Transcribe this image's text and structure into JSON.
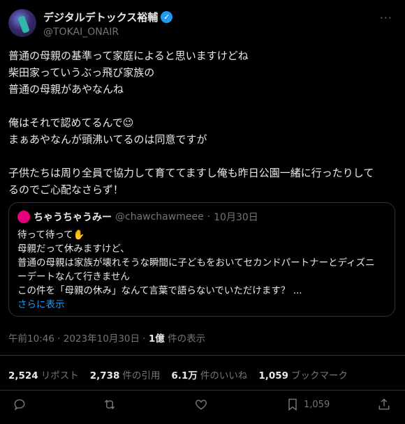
{
  "author": {
    "display_name": "デジタルデトックス裕輔",
    "handle": "@TOKAI_ONAIR",
    "verified_mark": "✓",
    "more_label": "···"
  },
  "tweet": {
    "lines": [
      "普通の母親の基準って家庭によると思いますけどね",
      "柴田家っていうぶっ飛び家族の",
      "普通の母親があやなんね",
      "",
      "俺はそれで認めてるんで😉",
      "まぁあやなんが頭沸いてるのは同意ですが",
      "",
      "子供たちは周り全員で協力して育ててますし俺も昨日公園一緒に行ったりして",
      "るのでご心配なさらず！"
    ]
  },
  "quote": {
    "name": "ちゃうちゃうみー",
    "handle": "@chawchawmeee",
    "dot": "·",
    "date": "10月30日",
    "lines": [
      "待って待って✋",
      "母親だって休みますけど、",
      "普通の母親は家族が壊れそうな瞬間に子どもをおいてセカンドパートナーとディズニ",
      "ーデートなんて行きません",
      "この件を「母親の休み」なんて言葉で語らないでいただけます？ ..."
    ],
    "show_more": "さらに表示"
  },
  "meta": {
    "time": "午前10:46",
    "sep": " · ",
    "date": "2023年10月30日",
    "sep2": " · ",
    "views": "1億",
    "views_label": " 件の表示"
  },
  "stats": {
    "reposts": "2,524",
    "reposts_label": "リポスト",
    "quotes": "2,738",
    "quotes_label": "件の引用",
    "likes": "6.1万",
    "likes_label": "件のいいね",
    "bookmarks": "1,059",
    "bookmarks_label": "ブックマーク"
  },
  "actions": {
    "bookmark_count": "1,059"
  },
  "colors": {
    "background": "#000000",
    "text": "#e7e9ea",
    "muted": "#71767b",
    "accent": "#1d9bf0",
    "border": "#2f3336"
  }
}
